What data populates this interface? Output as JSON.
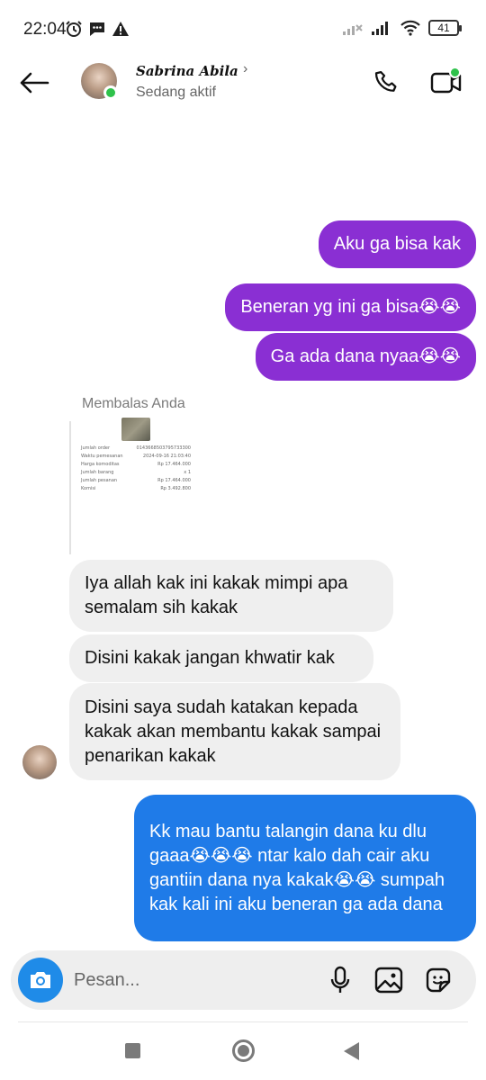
{
  "status_bar": {
    "time": "22:04",
    "battery": "41",
    "left_icons": [
      "alarm-icon",
      "message-icon",
      "warning-icon"
    ],
    "right_icons": [
      "signal-off-icon",
      "signal-icon",
      "wifi-icon",
      "battery-icon"
    ]
  },
  "header": {
    "contact_name": "Sabrina Abila",
    "status": "Sedang aktif",
    "online_color": "#2fc24b"
  },
  "messages": [
    {
      "side": "outgoing",
      "text": "Aku ga bisa kak"
    },
    {
      "side": "outgoing",
      "text": "Beneran yg ini ga bisa😭😭"
    },
    {
      "side": "outgoing",
      "text": "Ga ada dana nyaa😭😭"
    },
    {
      "side": "incoming",
      "text": "Iya allah kak ini kakak mimpi apa semalam sih kakak"
    },
    {
      "side": "incoming",
      "text": "Disini kakak jangan khwatir kak"
    },
    {
      "side": "incoming",
      "text": "Disini saya sudah katakan kepada kakak akan membantu kakak sampai penarikan kakak"
    },
    {
      "side": "outgoing",
      "text": "Kk mau bantu talangin dana ku dlu gaaa😭😭😭 ntar kalo dah cair aku gantiin dana nya kakak😭😭 sumpah kak kali ini aku beneran ga ada dana"
    }
  ],
  "reply": {
    "label": "Membalas Anda",
    "receipt_rows": [
      {
        "label": "Jumlah order",
        "value": "0143668503795733300"
      },
      {
        "label": "Waktu pemesanan",
        "value": "2024-09-16 21:03:40"
      },
      {
        "label": "Harga komoditas",
        "value": "Rp 17.464.000"
      },
      {
        "label": "Jumlah barang",
        "value": "x 1"
      },
      {
        "label": "Jumlah pesanan",
        "value": "Rp 17.464.000"
      },
      {
        "label": "Komisi",
        "value": "Rp 3.492.800"
      }
    ]
  },
  "composer": {
    "placeholder": "Pesan..."
  },
  "colors": {
    "outgoing_bubble": "#8a2fd3",
    "latest_bubble": "#1f7be8",
    "incoming_bubble": "#efefef"
  }
}
